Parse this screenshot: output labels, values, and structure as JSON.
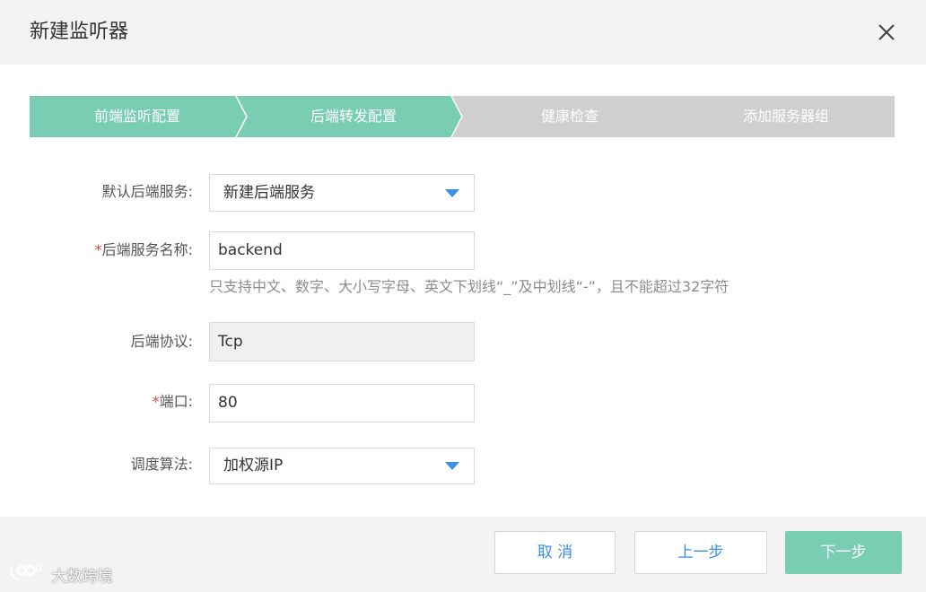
{
  "dialog": {
    "title": "新建监听器",
    "close_icon": "close-icon"
  },
  "steps": [
    {
      "label": "前端监听配置",
      "state": "done"
    },
    {
      "label": "后端转发配置",
      "state": "active"
    },
    {
      "label": "健康检查",
      "state": "pending"
    },
    {
      "label": "添加服务器组",
      "state": "pending"
    }
  ],
  "colors": {
    "step_done": "#79cdb3",
    "step_pending": "#cfcfcf",
    "accent": "#3a8ee6",
    "required": "#e0443c"
  },
  "form": {
    "default_backend": {
      "label": "默认后端服务:",
      "value": "新建后端服务"
    },
    "backend_name": {
      "required_mark": "*",
      "label": "后端服务名称:",
      "value": "backend",
      "hint": "只支持中文、数字、大小写字母、英文下划线“_”及中划线“-”，且不能超过32字符"
    },
    "protocol": {
      "label": "后端协议:",
      "value": "Tcp"
    },
    "port": {
      "required_mark": "*",
      "label": "端口:",
      "value": "80"
    },
    "algorithm": {
      "label": "调度算法:",
      "value": "加权源IP"
    }
  },
  "footer": {
    "cancel_label": "取 消",
    "prev_label": "上一步",
    "next_label": "下一步"
  },
  "watermark": {
    "text": "大数跨境"
  }
}
